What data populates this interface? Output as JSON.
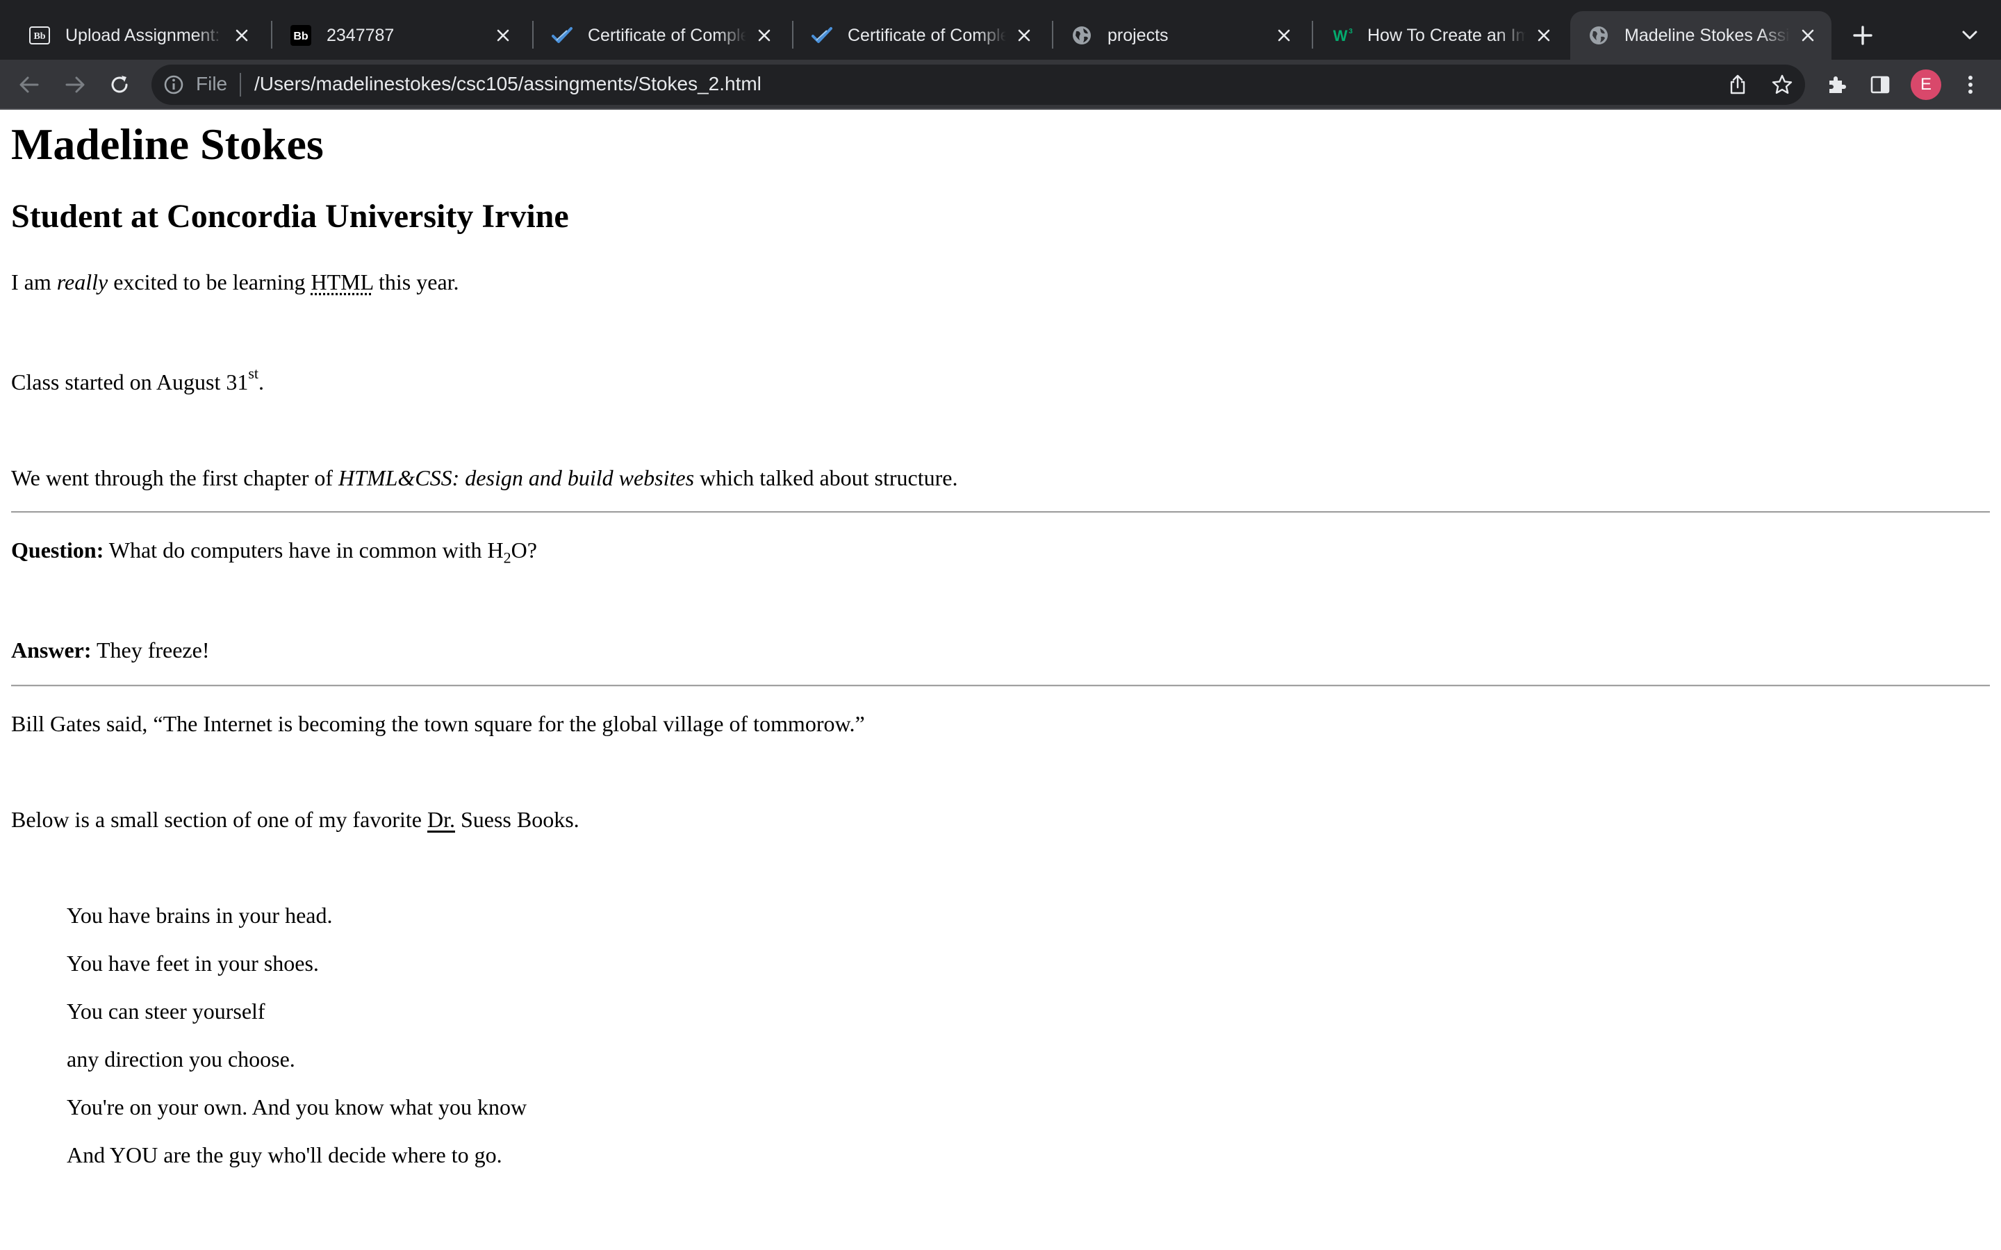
{
  "browser": {
    "tabs": [
      {
        "title": "Upload Assignment: A",
        "favicon": "blackboard-icon"
      },
      {
        "title": "2347787",
        "favicon": "blackboard-bb-icon"
      },
      {
        "title": "Certificate of Comple",
        "favicon": "checkmark-logo-icon"
      },
      {
        "title": "Certificate of Comple",
        "favicon": "checkmark-logo-icon"
      },
      {
        "title": "projects",
        "favicon": "globe-icon"
      },
      {
        "title": "How To Create an Ima",
        "favicon": "w3schools-icon"
      },
      {
        "title": "Madeline Stokes Assi",
        "favicon": "globe-icon",
        "active": true
      }
    ],
    "address": {
      "scheme": "File",
      "url": "/Users/madelinestokes/csc105/assingments/Stokes_2.html"
    },
    "profile_initial": "E"
  },
  "page": {
    "heading": "Madeline Stokes",
    "subheading": "Student at Concordia University Irvine",
    "intro": {
      "pre": "I am ",
      "em": "really",
      "mid": " excited to be learning ",
      "abbr": "HTML",
      "post": " this year."
    },
    "class_started": {
      "pre": "Class started on August 31",
      "sup": "st",
      "post": "."
    },
    "chapter": {
      "pre": "We went through the first chapter of ",
      "book": "HTML&CSS: design and build websites",
      "post": " which talked about structure."
    },
    "question": {
      "label": "Question:",
      "pre": " What do computers have in common with H",
      "sub": "2",
      "post": "O?"
    },
    "answer": {
      "label": "Answer:",
      "text": " They freeze!"
    },
    "quote": {
      "pre": "Bill Gates said, ",
      "text": "“The Internet is becoming the town square for the global village of tommorow.”"
    },
    "below": {
      "pre": "Below is a small section of one of my favorite ",
      "acronym": "Dr.",
      "post": " Suess Books."
    },
    "poem": [
      "You have brains in your head.",
      "You have feet in your shoes.",
      "You can steer yourself",
      "any direction you choose.",
      "You're on your own. And you know what you know",
      "And YOU are the guy who'll decide where to go."
    ]
  },
  "colors": {
    "tabstrip": "#202124",
    "toolbar": "#35363a",
    "omnibox": "#202124",
    "avatar": "#d9486b",
    "rule": "#a0a0a0"
  }
}
